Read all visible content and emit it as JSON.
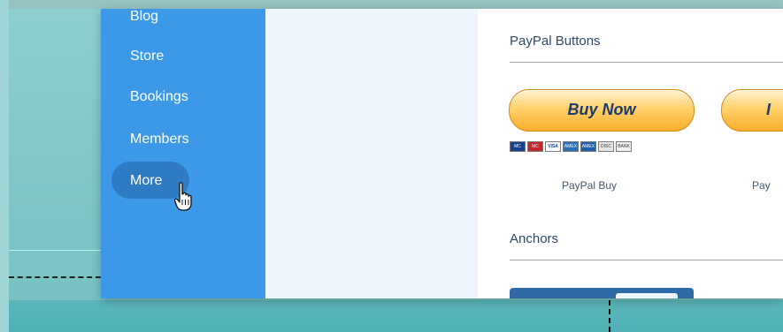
{
  "sidebar": {
    "items": [
      {
        "label": "Blog"
      },
      {
        "label": "Store"
      },
      {
        "label": "Bookings"
      },
      {
        "label": "Members"
      },
      {
        "label": "More"
      }
    ],
    "hovered": "More"
  },
  "sections": {
    "paypal_title": "PayPal Buttons",
    "buy_now_label": "Buy Now",
    "second_button_label": "I",
    "paypal_buy_caption": "PayPal Buy",
    "second_caption": "Pay",
    "anchors_title": "Anchors"
  },
  "payment_cards": [
    "MC",
    "MC",
    "VISA",
    "AMEX",
    "AMEX",
    "DISC",
    "BANK"
  ],
  "colors": {
    "sidebar": "#3b99e8",
    "active_pill": "#2f7cc4",
    "paypal_gold": "#ffc439",
    "paypal_navy": "#1e3a6e"
  },
  "icons": {
    "cursor": "hand-pointer-icon"
  }
}
